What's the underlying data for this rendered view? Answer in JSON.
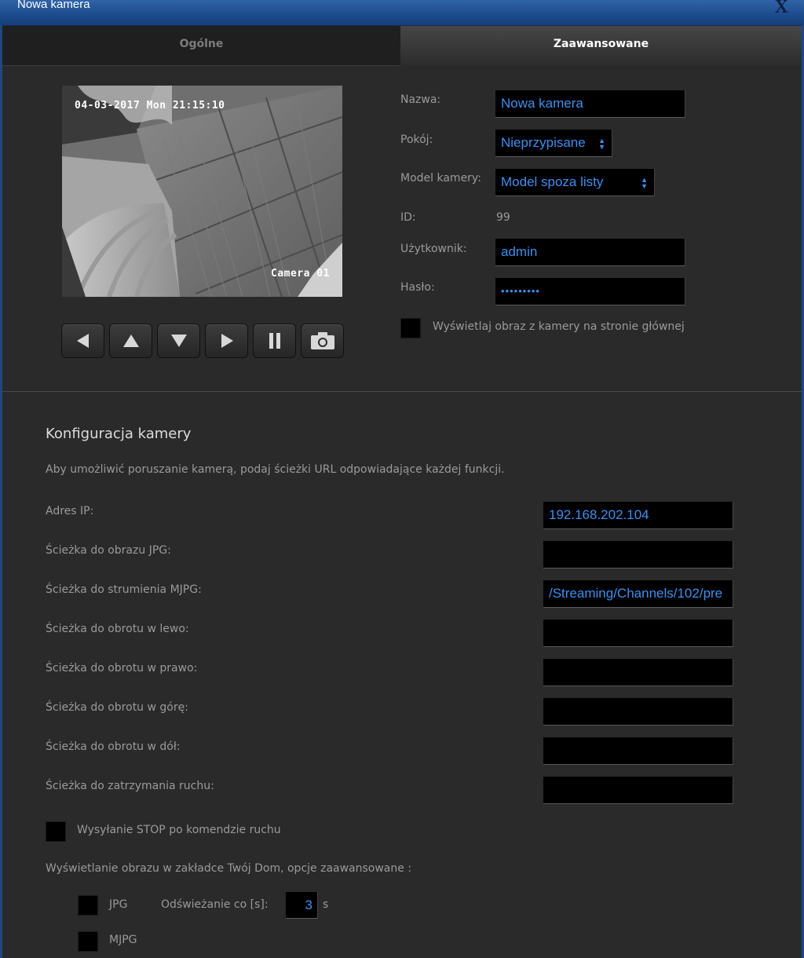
{
  "window": {
    "title": "Nowa kamera",
    "close_glyph": "X"
  },
  "tabs": [
    {
      "label": "Ogólne",
      "active": false
    },
    {
      "label": "Zaawansowane",
      "active": true
    }
  ],
  "preview": {
    "timestamp": "04-03-2017 Mon 21:15:10",
    "camera_label": "Camera 01"
  },
  "ptz_buttons": [
    "arrow-left-icon",
    "arrow-up-icon",
    "arrow-down-icon",
    "arrow-right-icon",
    "pause-icon",
    "camera-snapshot-icon"
  ],
  "general": {
    "name_label": "Nazwa:",
    "name_value": "Nowa kamera",
    "room_label": "Pokój:",
    "room_value": "Nieprzypisane",
    "model_label": "Model kamery:",
    "model_value": "Model spoza listy",
    "id_label": "ID:",
    "id_value": "99",
    "user_label": "Użytkownik:",
    "user_value": "admin",
    "password_label": "Hasło:",
    "password_value": "•••••••••",
    "show_on_home_label": "Wyświetlaj obraz z kamery na stronie głównej",
    "show_on_home_checked": false
  },
  "config": {
    "title": "Konfiguracja kamery",
    "description": "Aby umożliwić poruszanie kamerą, podaj ścieżki URL odpowiadające każdej funkcji.",
    "fields": [
      {
        "label": "Adres IP:",
        "value": "192.168.202.104"
      },
      {
        "label": "Ścieżka do obrazu JPG:",
        "value": ""
      },
      {
        "label": "Ścieżka do strumienia MJPG:",
        "value": "/Streaming/Channels/102/pre"
      },
      {
        "label": "Ścieżka do obrotu w lewo:",
        "value": ""
      },
      {
        "label": "Ścieżka do obrotu w prawo:",
        "value": ""
      },
      {
        "label": "Ścieżka do obrotu w górę:",
        "value": ""
      },
      {
        "label": "Ścieżka do obrotu w dół:",
        "value": ""
      },
      {
        "label": "Ścieżka do zatrzymania ruchu:",
        "value": ""
      }
    ],
    "send_stop_label": "Wysyłanie STOP po komendzie ruchu",
    "send_stop_checked": false,
    "display_options_label": "Wyświetlanie obrazu w zakładce Twój Dom, opcje zaawansowane :",
    "jpg_label": "JPG",
    "refresh_label": "Odświeżanie co [s]:",
    "refresh_value": "3",
    "refresh_unit": "s",
    "mjpg_label": "MJPG"
  },
  "colors": {
    "accent_text": "#3e8ff0",
    "title_bar": "#1c4b8c",
    "background": "#2a2a2a"
  }
}
